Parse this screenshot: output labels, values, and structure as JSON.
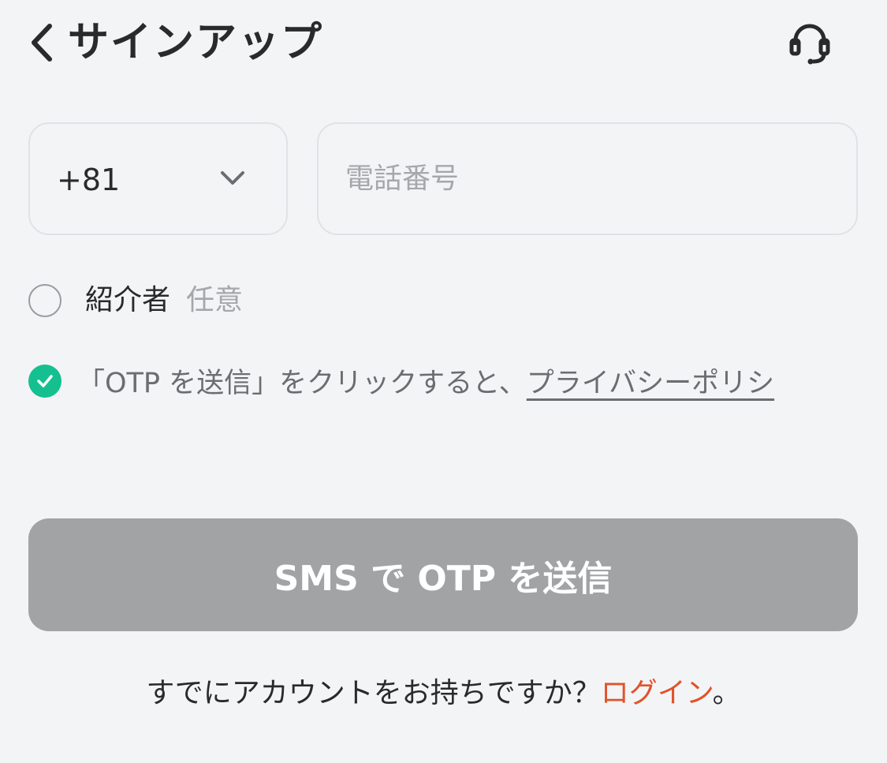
{
  "header": {
    "title": "サインアップ",
    "back_icon": "chevron-left-icon",
    "support_icon": "headset-icon"
  },
  "phone": {
    "country_code": "+81",
    "placeholder": "電話番号",
    "value": ""
  },
  "referrer": {
    "label": "紹介者",
    "optional": "任意",
    "checked": false
  },
  "agreement": {
    "checked": true,
    "text": "「OTP を送信」をクリックすると、",
    "link": "プライバシーポリシ"
  },
  "submit": {
    "label": "SMS で OTP を送信",
    "enabled": false
  },
  "footer": {
    "text": "すでにアカウントをお持ちですか？",
    "login_link": "ログイン",
    "suffix": "。"
  },
  "colors": {
    "accent_green": "#14c08f",
    "link_orange": "#e0532b",
    "disabled_button": "#a2a3a5",
    "background": "#f3f4f6"
  }
}
